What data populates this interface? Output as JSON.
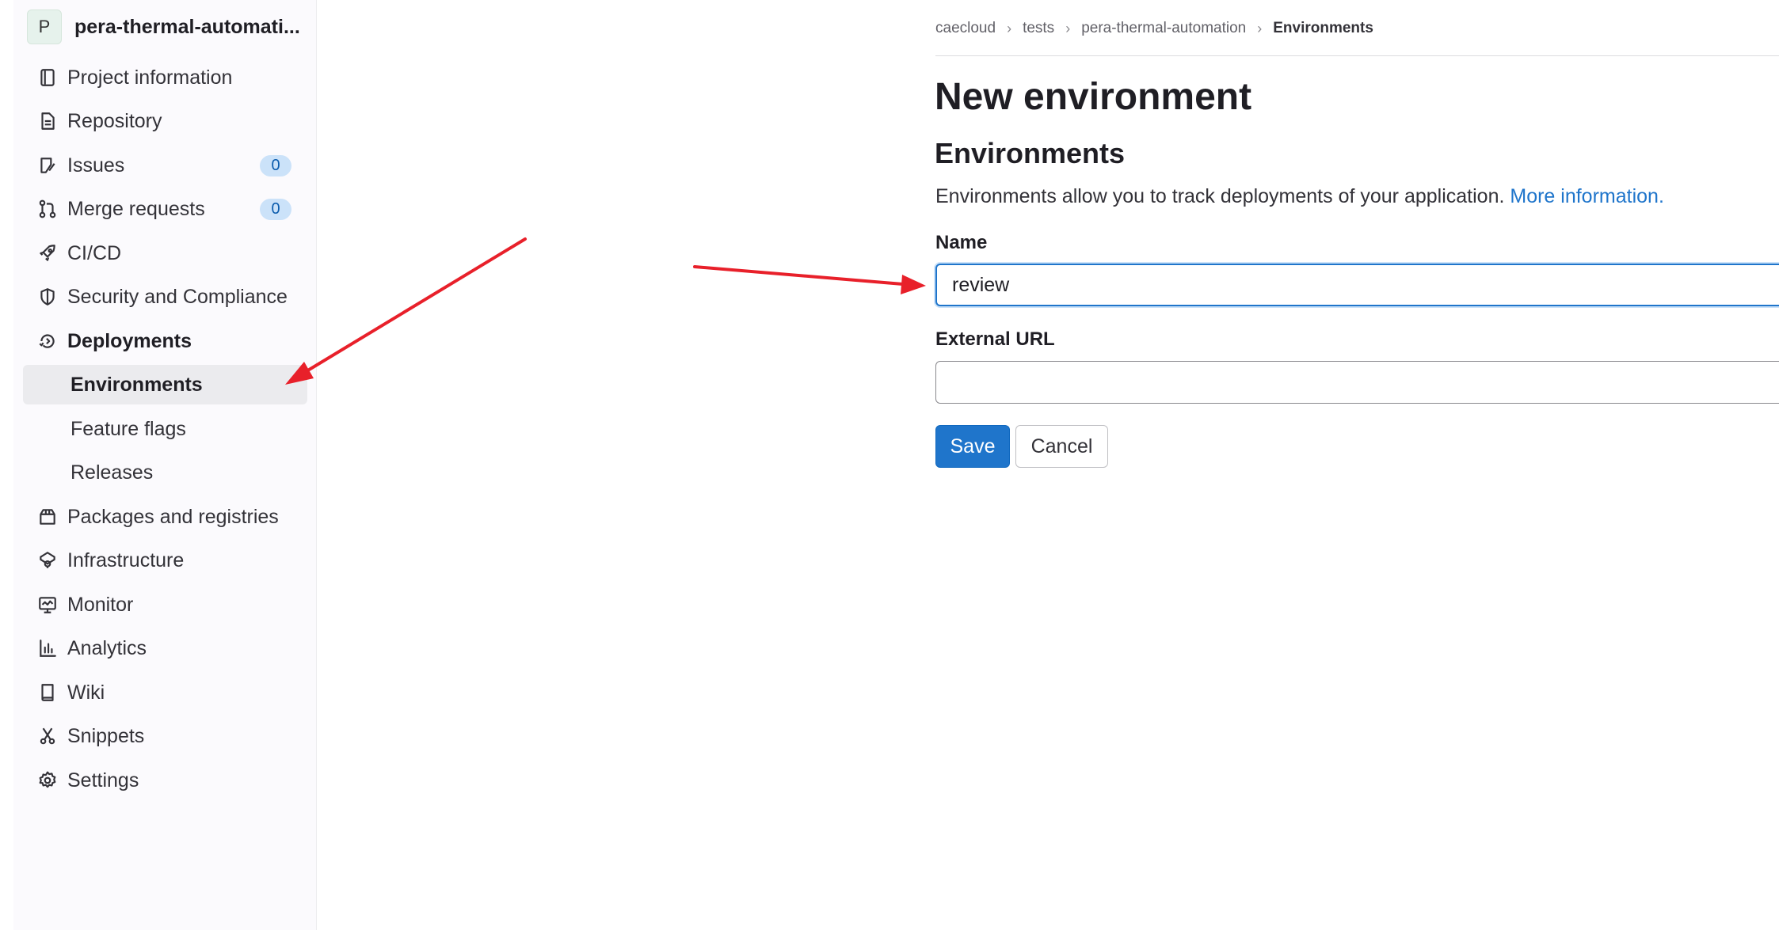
{
  "sidebar": {
    "project_avatar_letter": "P",
    "project_name": "pera-thermal-automati...",
    "items": [
      {
        "label": "Project information",
        "icon": "project-info-icon"
      },
      {
        "label": "Repository",
        "icon": "document-icon"
      },
      {
        "label": "Issues",
        "icon": "issues-icon",
        "badge": "0"
      },
      {
        "label": "Merge requests",
        "icon": "merge-request-icon",
        "badge": "0"
      },
      {
        "label": "CI/CD",
        "icon": "rocket-icon"
      },
      {
        "label": "Security and Compliance",
        "icon": "shield-icon"
      },
      {
        "label": "Deployments",
        "icon": "deployments-icon"
      },
      {
        "label": "Environments"
      },
      {
        "label": "Feature flags"
      },
      {
        "label": "Releases"
      },
      {
        "label": "Packages and registries",
        "icon": "package-icon"
      },
      {
        "label": "Infrastructure",
        "icon": "cloud-gear-icon"
      },
      {
        "label": "Monitor",
        "icon": "monitor-icon"
      },
      {
        "label": "Analytics",
        "icon": "chart-icon"
      },
      {
        "label": "Wiki",
        "icon": "book-icon"
      },
      {
        "label": "Snippets",
        "icon": "scissors-icon"
      },
      {
        "label": "Settings",
        "icon": "gear-icon"
      }
    ]
  },
  "breadcrumb": [
    "caecloud",
    "tests",
    "pera-thermal-automation",
    "Environments"
  ],
  "breadcrumb_separator": "›",
  "main": {
    "title": "New environment",
    "section_title": "Environments",
    "description": "Environments allow you to track deployments of your application.",
    "more_info_link": "More information.",
    "name_label": "Name",
    "name_value": "review",
    "external_url_label": "External URL",
    "external_url_value": "",
    "save_label": "Save",
    "cancel_label": "Cancel"
  },
  "colors": {
    "accent": "#1f75cb",
    "annotation_arrow": "#e8202a",
    "active_item_bg": "#ebebee",
    "badge_bg": "#cbe2f9"
  }
}
